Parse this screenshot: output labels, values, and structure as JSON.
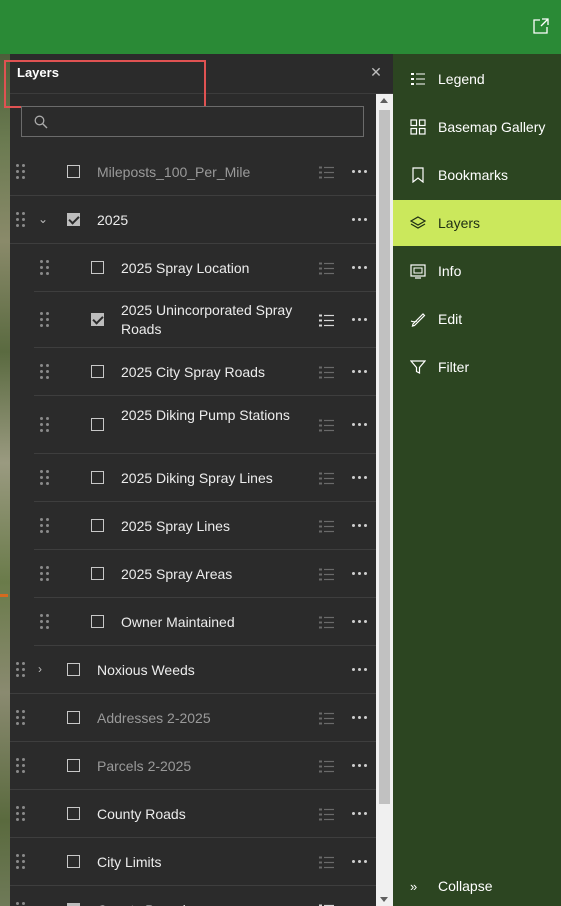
{
  "header": {
    "share_icon": "share-external-icon"
  },
  "panel": {
    "title": "Layers",
    "close_icon": "close-icon",
    "search": {
      "placeholder": "",
      "value": ""
    }
  },
  "layers": [
    {
      "label": "Mileposts_100_Per_Mile",
      "checked": false,
      "dim": true,
      "child": false,
      "expand": ""
    },
    {
      "label": "2025",
      "checked": true,
      "dim": false,
      "child": false,
      "expand": "⌄"
    },
    {
      "label": "2025 Spray Location",
      "checked": false,
      "dim": false,
      "child": true
    },
    {
      "label": "2025 Unincorporated Spray Roads",
      "checked": true,
      "dim": false,
      "child": true
    },
    {
      "label": "2025 City Spray Roads",
      "checked": false,
      "dim": false,
      "child": true
    },
    {
      "label": "2025 Diking Pump Stations",
      "checked": false,
      "dim": false,
      "child": true
    },
    {
      "label": "2025 Diking Spray Lines",
      "checked": false,
      "dim": false,
      "child": true
    },
    {
      "label": "2025 Spray Lines",
      "checked": false,
      "dim": false,
      "child": true
    },
    {
      "label": "2025 Spray Areas",
      "checked": false,
      "dim": false,
      "child": true
    },
    {
      "label": "Owner Maintained",
      "checked": false,
      "dim": false,
      "child": true
    },
    {
      "label": "Noxious Weeds",
      "checked": false,
      "dim": false,
      "child": false,
      "expand": "›"
    },
    {
      "label": "Addresses 2-2025",
      "checked": false,
      "dim": true,
      "child": false
    },
    {
      "label": "Parcels 2-2025",
      "checked": false,
      "dim": true,
      "child": false
    },
    {
      "label": "County Roads",
      "checked": false,
      "dim": false,
      "child": false
    },
    {
      "label": "City Limits",
      "checked": false,
      "dim": false,
      "child": false
    },
    {
      "label": "County Boundary",
      "checked": true,
      "dim": false,
      "child": false
    }
  ],
  "nav": {
    "items": [
      {
        "label": "Legend",
        "icon": "legend-list-icon",
        "active": false
      },
      {
        "label": "Basemap Gallery",
        "icon": "basemap-grid-icon",
        "active": false
      },
      {
        "label": "Bookmarks",
        "icon": "bookmark-icon",
        "active": false
      },
      {
        "label": "Layers",
        "icon": "layers-icon",
        "active": true
      },
      {
        "label": "Info",
        "icon": "info-icon",
        "active": false
      },
      {
        "label": "Edit",
        "icon": "edit-icon",
        "active": false
      },
      {
        "label": "Filter",
        "icon": "filter-icon",
        "active": false
      }
    ],
    "collapse_label": "Collapse"
  },
  "colors": {
    "header_green": "#2a8a36",
    "nav_dark_green": "#2c4521",
    "active_lime": "#cbe85c",
    "panel_bg": "#2b2b2b",
    "annotation_red": "#e05252"
  }
}
